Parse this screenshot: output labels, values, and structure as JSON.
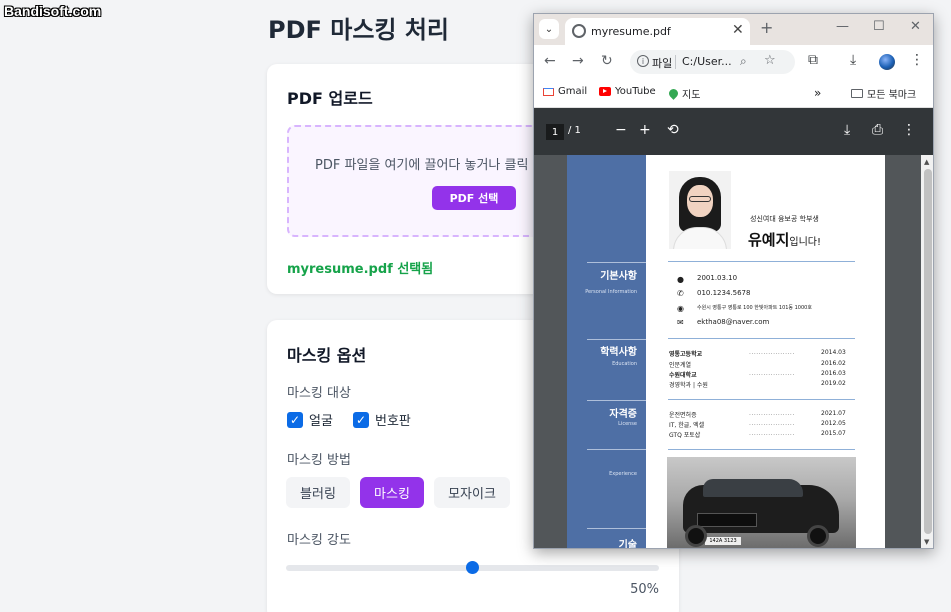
{
  "watermark": "Bandisoft.com",
  "page": {
    "title": "PDF 마스킹 처리"
  },
  "upload": {
    "title": "PDF 업로드",
    "dropzone_text": "PDF 파일을 여기에 끌어다 놓거나 클릭",
    "button": "PDF 선택",
    "selected_file": "myresume.pdf 선택됨"
  },
  "options": {
    "title": "마스킹 옵션",
    "target_label": "마스킹 대상",
    "targets": [
      {
        "label": "얼굴",
        "checked": true
      },
      {
        "label": "번호판",
        "checked": true
      }
    ],
    "method_label": "마스킹 방법",
    "methods": [
      {
        "label": "블러링",
        "active": false
      },
      {
        "label": "마스킹",
        "active": true
      },
      {
        "label": "모자이크",
        "active": false
      }
    ],
    "strength_label": "마스킹 강도",
    "strength_value": 0.5,
    "strength_text": "50%"
  },
  "browser": {
    "tab_title": "myresume.pdf",
    "omnibox_prefix": "파일",
    "url": "C:/User...",
    "bookmarks": [
      {
        "label": "Gmail",
        "icon": "gmail-icon"
      },
      {
        "label": "YouTube",
        "icon": "youtube-icon"
      },
      {
        "label": "지도",
        "icon": "maps-icon"
      }
    ],
    "all_bookmarks": "모든 북마크",
    "pdf": {
      "current_page": "1",
      "total_pages": "/ 1"
    }
  },
  "resume": {
    "school_line": "성신여대 융보공 학부생",
    "name": "유예지",
    "name_suffix": "입니다!",
    "sections": [
      {
        "title": "기본사항",
        "sub": "Personal Information"
      },
      {
        "title": "학력사항",
        "sub": "Education"
      },
      {
        "title": "자격증",
        "sub": "License"
      },
      {
        "title": "",
        "sub": "Experience"
      },
      {
        "title": "기술",
        "sub": ""
      }
    ],
    "info": {
      "birth": "2001.03.10",
      "phone": "010.1234.5678",
      "address": "수원시 영통구 영통로 100 한빛아파트 101동 1000호",
      "email": "ektha08@naver.com"
    },
    "education": [
      {
        "name": "영통고등학교",
        "date": "2014.03",
        "bold": true
      },
      {
        "name": "인문계열",
        "date": "2016.02",
        "bold": false
      },
      {
        "name": "수원대학교",
        "date": "2016.03",
        "bold": true
      },
      {
        "name": "경영학과 | 수원",
        "date": "2019.02",
        "bold": false
      }
    ],
    "licenses": [
      {
        "name": "운전면허증",
        "date": "2021.07"
      },
      {
        "name": "IT, 한글, 엑셀",
        "date": "2012.05"
      },
      {
        "name": "GTQ 포토샵",
        "date": "2015.07"
      }
    ],
    "dots": "...................",
    "plate": "142A 3123"
  }
}
